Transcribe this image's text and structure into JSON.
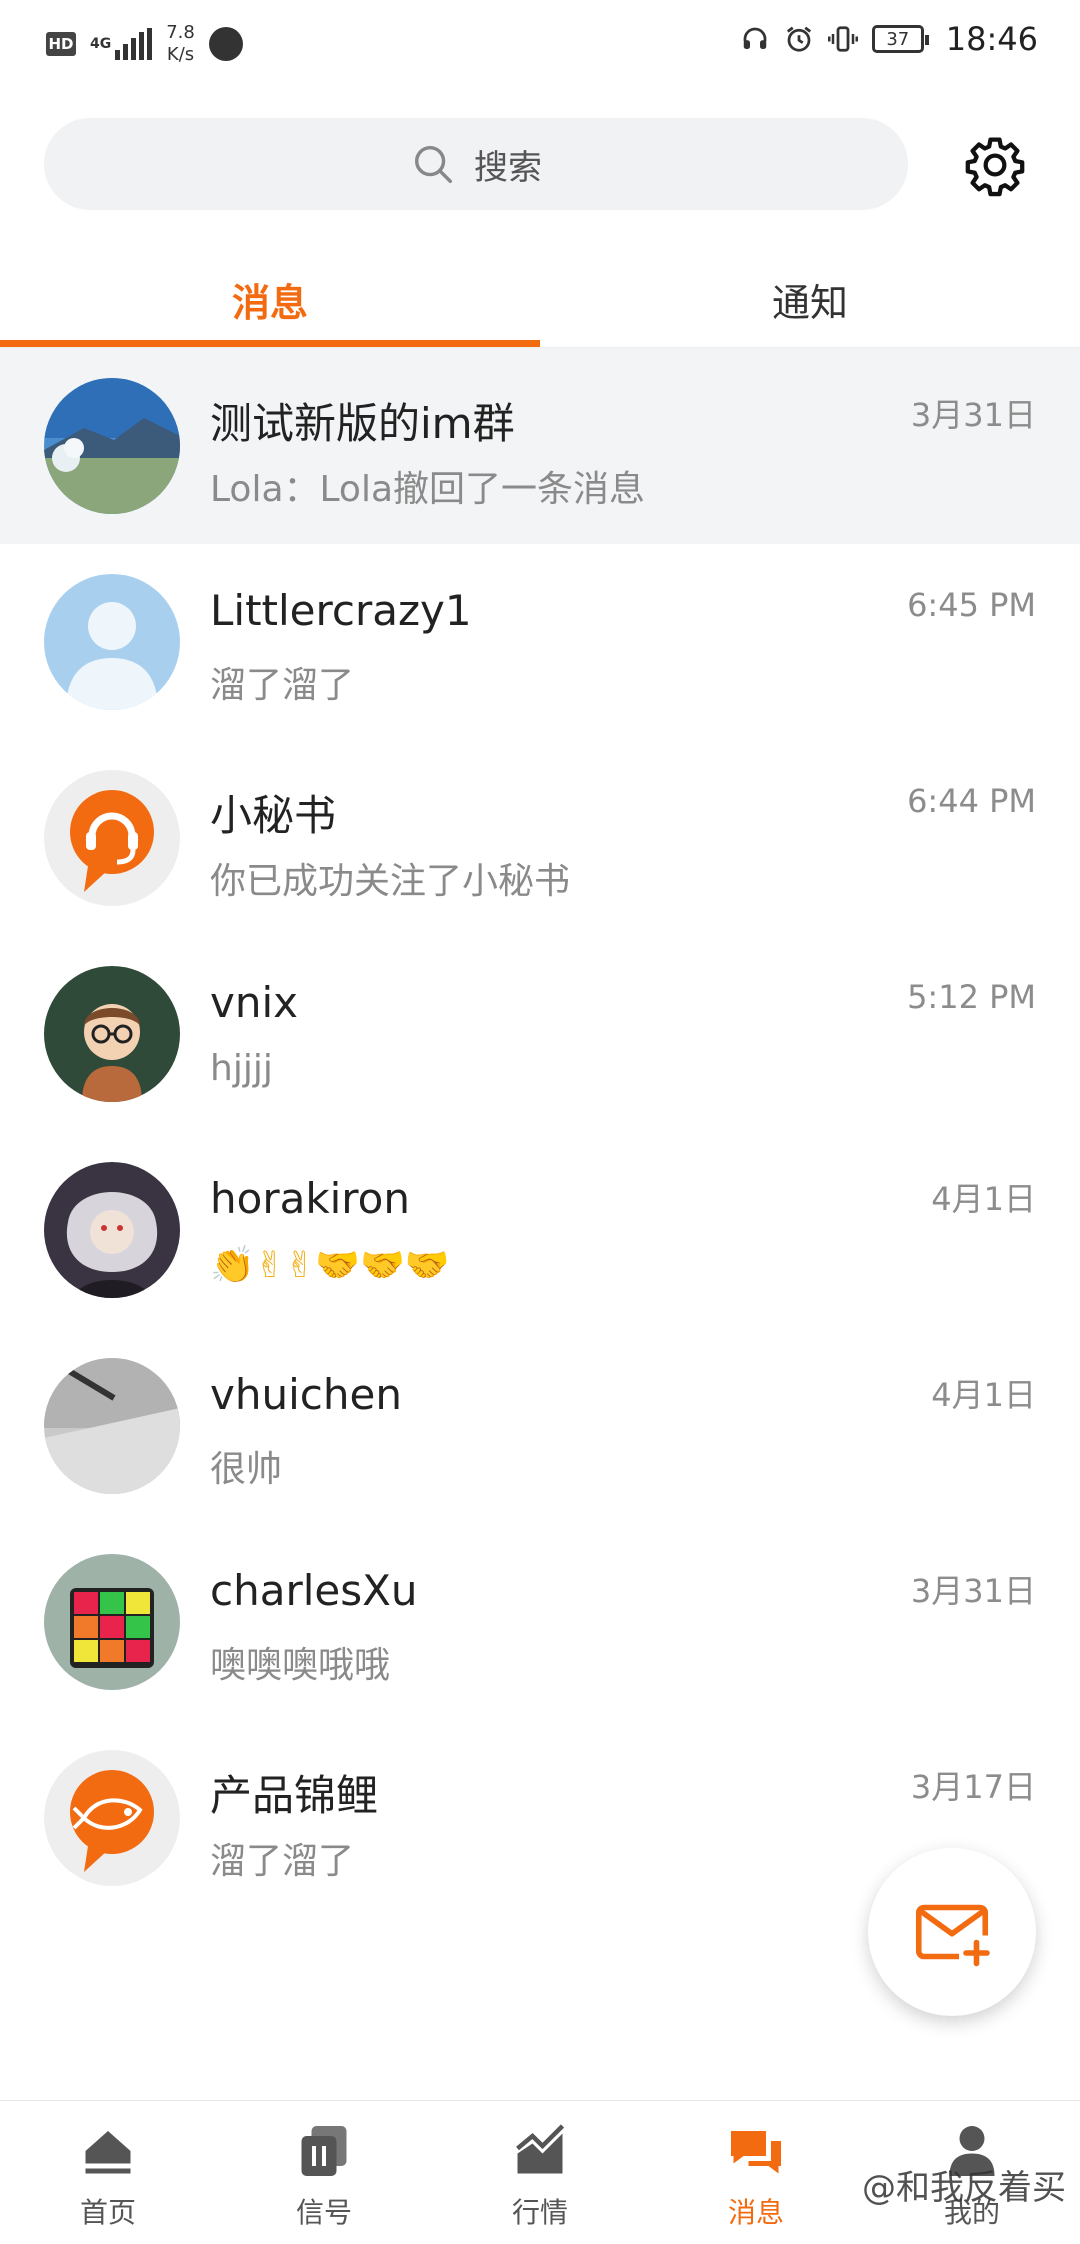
{
  "status_bar": {
    "hd": "HD",
    "network": "4G",
    "speed_value": "7.8",
    "speed_unit": "K/s",
    "battery": "37",
    "time": "18:46"
  },
  "search": {
    "placeholder": "搜索"
  },
  "tabs": [
    {
      "label": "消息",
      "active": true
    },
    {
      "label": "通知",
      "active": false
    }
  ],
  "accent_color": "#f26b11",
  "conversations": [
    {
      "name": "测试新版的im群",
      "preview": "Lola：Lola撤回了一条消息",
      "time": "3月31日",
      "highlight": true
    },
    {
      "name": "Littlercrazy1",
      "preview": "溜了溜了",
      "time": "6:45 PM"
    },
    {
      "name": "小秘书",
      "preview": "你已成功关注了小秘书",
      "time": "6:44 PM"
    },
    {
      "name": "vnix",
      "preview": "hjjjj",
      "time": "5:12 PM"
    },
    {
      "name": "horakiron",
      "preview": "👏✌✌🤝🤝🤝",
      "time": "4月1日"
    },
    {
      "name": "vhuichen",
      "preview": "很帅",
      "time": "4月1日"
    },
    {
      "name": "charlesXu",
      "preview": " 噢噢噢哦哦",
      "time": "3月31日"
    },
    {
      "name": "产品锦鲤",
      "preview": "溜了溜了",
      "time": "3月17日"
    }
  ],
  "bottom_nav": [
    {
      "label": "首页",
      "icon": "home-icon"
    },
    {
      "label": "信号",
      "icon": "signal-icon"
    },
    {
      "label": "行情",
      "icon": "market-chart-icon"
    },
    {
      "label": "消息",
      "icon": "message-icon",
      "active": true
    },
    {
      "label": "我的",
      "icon": "profile-icon"
    }
  ],
  "watermark": "@和我反着买"
}
